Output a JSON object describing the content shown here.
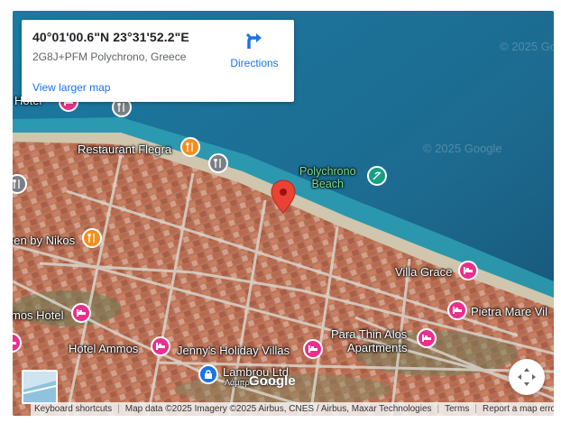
{
  "infocard": {
    "coordinates": "40°01'00.6\"N 23°31'52.2\"E",
    "address": "2G8J+PFM Polychrono, Greece",
    "directions_label": "Directions",
    "view_larger_label": "View larger map"
  },
  "map": {
    "watermark": "© 2025 Google",
    "google_logo": "Google",
    "places": {
      "hotel_top": "Hotel",
      "restaurant_flegra": "Restaurant Flegra",
      "polychrono_beach_line1": "Polychrono",
      "polychrono_beach_line2": "Beach",
      "green_by_nikos": "een by Nikos",
      "villa_grace": "Villa Grace",
      "ammos_hotel": "mos Hotel",
      "pietra_mare": "Pietra Mare Vil",
      "hotel_ammos": "Hotel Ammos",
      "jennys_villas": "Jenny's Holiday Villas",
      "para_thin_alos_line1": "Para Thin Alos",
      "para_thin_alos_line2": "Apartments",
      "lambrou_line1": "Lambrou Ltd",
      "lambrou_line2": "Λάμπρου ΕΠΕ"
    },
    "colors": {
      "sea": "#1b6f96",
      "marker": "#ea4335",
      "hotel": "#e8308c",
      "food": "#f28e1c",
      "beach": "#16a085"
    }
  },
  "footer": {
    "keyboard_shortcuts": "Keyboard shortcuts",
    "map_data": "Map data ©2025 Imagery ©2025 Airbus, CNES / Airbus, Maxar Technologies",
    "terms": "Terms",
    "report": "Report a map error"
  },
  "icons": [
    "directions-icon",
    "location-marker-icon",
    "hotel-icon",
    "restaurant-icon",
    "beach-icon",
    "navigation-icon",
    "map-type-thumbnail-icon"
  ]
}
